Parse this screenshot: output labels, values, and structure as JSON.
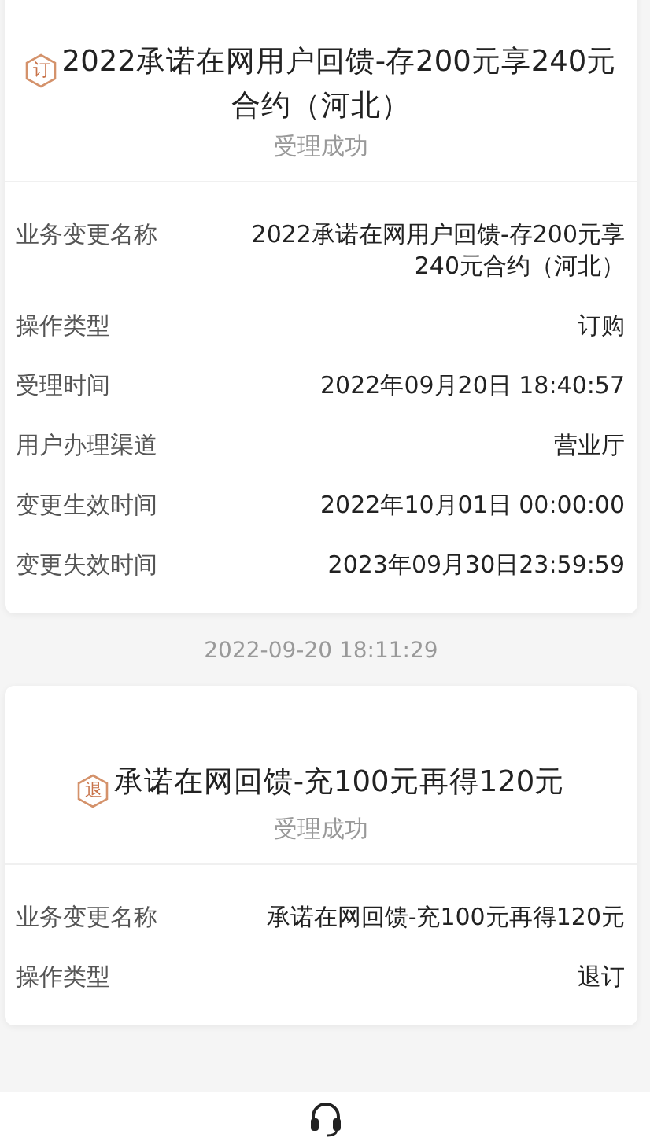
{
  "records": [
    {
      "badge": "订",
      "title": "2022承诺在网用户回馈-存200元享240元合约（河北）",
      "status": "受理成功",
      "fields": [
        {
          "label": "业务变更名称",
          "value": "2022承诺在网用户回馈-存200元享240元合约（河北）"
        },
        {
          "label": "操作类型",
          "value": "订购"
        },
        {
          "label": "受理时间",
          "value": "2022年09月20日 18:40:57"
        },
        {
          "label": "用户办理渠道",
          "value": "营业厅"
        },
        {
          "label": "变更生效时间",
          "value": "2022年10月01日 00:00:00"
        },
        {
          "label": "变更失效时间",
          "value": "2023年09月30日23:59:59"
        }
      ]
    },
    {
      "timestamp": "2022-09-20 18:11:29",
      "badge": "退",
      "title": "承诺在网回馈-充100元再得120元",
      "status": "受理成功",
      "fields": [
        {
          "label": "业务变更名称",
          "value": "承诺在网回馈-充100元再得120元"
        },
        {
          "label": "操作类型",
          "value": "退订"
        }
      ]
    }
  ]
}
